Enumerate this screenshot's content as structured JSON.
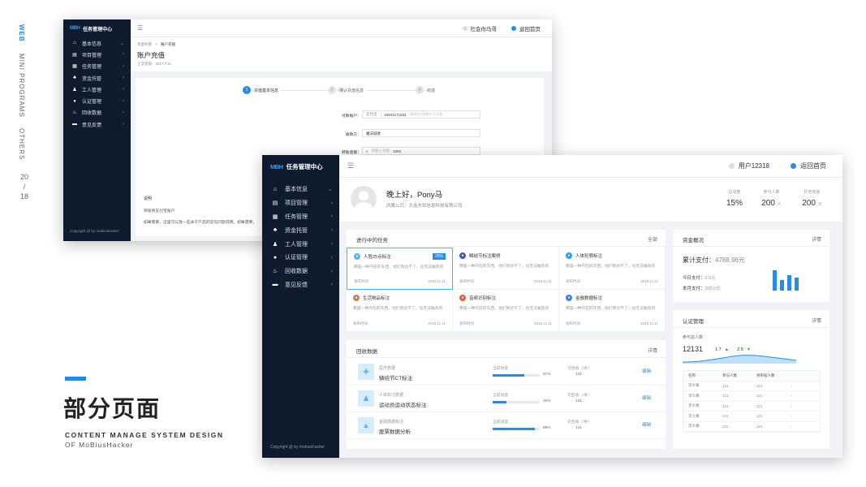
{
  "sidenav": {
    "items": [
      "WEB",
      "MINI PROGRAMS",
      "OTHERS"
    ],
    "page": "20",
    "sep": "/",
    "total": "18"
  },
  "heading": {
    "title": "部分页面",
    "sub1": "CONTENT MANAGE SYSTEM DESIGN",
    "sub2": "OF MoBiusHacker"
  },
  "brand": {
    "mark": "MBH",
    "name": "任务管理中心",
    "copyright": "Copyright @  by mobiushacker"
  },
  "menu": [
    "基本信息",
    "项目管理",
    "任务管理",
    "资金托管",
    "工人管理",
    "认证管理",
    "回收数据",
    "意见反馈"
  ],
  "menu_icons": [
    "⌂",
    "▤",
    "▦",
    "♣",
    "♟",
    "●",
    "♨",
    "▬"
  ],
  "w1": {
    "user": "社会你马哥",
    "home": "返回首页",
    "crumb1": "资金托管",
    "crumb_sep": ">",
    "crumb2": "账户充值",
    "title": "账户充值",
    "subtitle": "上次充值：2017.7.11",
    "steps": [
      {
        "n": "1",
        "label": "充值基本信息"
      },
      {
        "n": "2",
        "label": "确认充值信息"
      },
      {
        "n": "3",
        "label": "完成"
      }
    ],
    "f1_label": "付款账户：",
    "f1_prefix": "支付宝",
    "f1_value": "15041171621",
    "f1_hint": "请保证付款账户已开通...",
    "f2_label": "收款方：",
    "f2_value": "魔法城者",
    "f3_label": "转账金额：",
    "f3_prefix": "¥",
    "f3_hint": "请输入金额",
    "f3_value": "1000",
    "note_title": "说明",
    "note1": "转账到支付宝账户",
    "note2": "如果需要，这里可以放一些关于产品的常见问题说明。如果需要，"
  },
  "w2": {
    "user": "用户12318",
    "home": "返回首页",
    "greet": "晚上好，Pony马",
    "company": "所属公司：大连东软信息科技有限公司",
    "stats": [
      {
        "label": "总进度",
        "value": "15%",
        "unit": ""
      },
      {
        "label": "参与人数",
        "value": "200",
        "unit": "人"
      },
      {
        "label": "托管资金",
        "value": "200",
        "unit": "元"
      }
    ],
    "tasks_title": "进行中的任务",
    "tasks_all": "全部",
    "tasks": [
      {
        "name": "人脸25点标注",
        "badge": "25%",
        "desc": "那是一种内在的东西，他们到达不了，也无法触及的",
        "pub": "发布时间",
        "date": "2018.11.11",
        "color": "#5ab0ee"
      },
      {
        "name": "鳞结节标注案例",
        "badge": "",
        "desc": "那是一种内在的东西，他们到达不了，也无法触及的",
        "pub": "发布时间",
        "date": "2018.11.11",
        "color": "#3b5fb5"
      },
      {
        "name": "人体轮廓标注",
        "badge": "",
        "desc": "那是一种内在的东西，他们到达不了，也无法触及的",
        "pub": "发布时间",
        "date": "2018.11.11",
        "color": "#2a9df4"
      },
      {
        "name": "生活物品标注",
        "badge": "",
        "desc": "那是一种内在的东西，他们到达不了，也无法触及的",
        "pub": "发布时间",
        "date": "2018.11.11",
        "color": "#c0845a"
      },
      {
        "name": "音频识别标注",
        "badge": "",
        "desc": "那是一种内在的东西，他们到达不了，也无法触及的",
        "pub": "发布时间",
        "date": "2018.11.11",
        "color": "#e0603a"
      },
      {
        "name": "金融数据标注",
        "badge": "",
        "desc": "那是一种内在的东西，他们到达不了，也无法触及的",
        "pub": "发布时间",
        "date": "2018.11.11",
        "color": "#3b7fe0"
      }
    ],
    "recycle_title": "回收数据",
    "recycle_more": "详情",
    "recycle": [
      {
        "cat": "医疗数据",
        "name": "鳞结节CT标注",
        "rate_label": "当前进度",
        "pct": "67%",
        "prog": 67,
        "ret_label": "可回收（/条）",
        "ret": "141",
        "action": "编辑",
        "icon": "✚"
      },
      {
        "cat": "人体标注数据",
        "name": "运动员运动状态标注",
        "rate_label": "当前进度",
        "pct": "30%",
        "prog": 30,
        "ret_label": "可回收（/条）",
        "ret": "141",
        "action": "编辑",
        "icon": "♟"
      },
      {
        "cat": "金融数据标注",
        "name": "股票数据分析",
        "rate_label": "当前进度",
        "pct": "89%",
        "prog": 89,
        "ret_label": "可回收（/条）",
        "ret": "141",
        "action": "编辑",
        "icon": "▲"
      }
    ],
    "fund_title": "资金概况",
    "fund_more": "详情",
    "fund_total_label": "累计支付：",
    "fund_total": "4788.96元",
    "fund_today_label": "今日支付：",
    "fund_today": "0.0元",
    "fund_month_label": "本月支付：",
    "fund_month": "300.0元",
    "fund_bars": [
      0.85,
      0.45,
      0.65,
      0.55
    ],
    "auth_title": "认证管理",
    "auth_more": "详情",
    "auth_label": "参与总人数",
    "auth_total": "12131",
    "auth_c1": "1.7",
    "auth_c2": "2.5",
    "table_head": [
      "名称",
      "参与人数",
      "待审核人数",
      ""
    ],
    "table_rows": [
      [
        "李大嘴",
        "121",
        "121",
        "›"
      ],
      [
        "李大嘴",
        "121",
        "121",
        "›"
      ],
      [
        "李大嘴",
        "121",
        "121",
        "›"
      ],
      [
        "李大嘴",
        "121",
        "121",
        "›"
      ],
      [
        "李大嘴",
        "121",
        "121",
        "›"
      ]
    ]
  }
}
